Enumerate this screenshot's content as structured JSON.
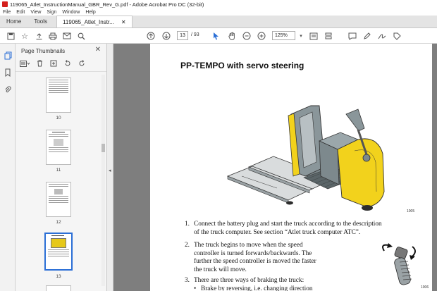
{
  "window": {
    "title": "119065_Atlet_InstructionManual_GBR_Rev_G.pdf - Adobe Acrobat Pro DC (32-bit)"
  },
  "menu": [
    "File",
    "Edit",
    "View",
    "Sign",
    "Window",
    "Help"
  ],
  "tabs": {
    "home": "Home",
    "tools": "Tools",
    "document": "119065_Atlet_Instr..."
  },
  "toolbar": {
    "page_current": "13",
    "page_total": "/ 93",
    "zoom": "125%"
  },
  "panel": {
    "title": "Page Thumbnails",
    "thumbnails": [
      {
        "label": "10"
      },
      {
        "label": "11"
      },
      {
        "label": "12"
      },
      {
        "label": "13"
      }
    ]
  },
  "document": {
    "heading": "PP-TEMPO with servo steering",
    "figure1_caption": "1005",
    "figure2_caption": "1006",
    "items": [
      {
        "num": "1.",
        "lines": [
          "Connect the battery plug and start the truck according to the description",
          "of the truck computer. See section “Atlet truck computer ATC”."
        ]
      },
      {
        "num": "2.",
        "lines": [
          "The truck begins to move when the speed",
          "controller is turned forwards/backwards. The",
          "further the speed controller is moved the faster",
          "the truck will move."
        ]
      },
      {
        "num": "3.",
        "lines": [
          "There are three ways of braking the truck:"
        ]
      }
    ],
    "bullet": "Brake by reversing, i.e. changing direction"
  },
  "colors": {
    "accent": "#2b6fd6",
    "truck_yellow": "#f2d21c",
    "truck_grey": "#8a969a",
    "acrobat_red": "#d4201c"
  }
}
